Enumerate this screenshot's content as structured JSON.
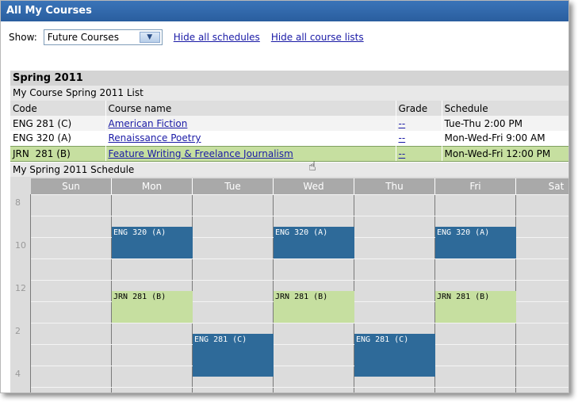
{
  "window": {
    "title": "All My Courses"
  },
  "show": {
    "label": "Show:",
    "selected": "Future Courses",
    "arrow_icon": "chevron-down-icon",
    "links": [
      "Hide all schedules",
      "Hide all course lists"
    ]
  },
  "term": {
    "name": "Spring 2011",
    "list_title": "My Course Spring 2011 List",
    "columns": [
      "Code",
      "Course name",
      "Grade",
      "Schedule"
    ],
    "courses": [
      {
        "code": "ENG 281 (C)",
        "name": "American Fiction",
        "grade": "--",
        "schedule": "Tue-Thu 2:00 PM"
      },
      {
        "code": "ENG 320 (A)",
        "name": "Renaissance Poetry",
        "grade": "--",
        "schedule": "Mon-Wed-Fri 9:00 AM"
      },
      {
        "code": "JRN  281 (B)",
        "name": "Feature Writing & Freelance Journalism",
        "grade": "--",
        "schedule": "Mon-Wed-Fri 12:00 PM"
      }
    ],
    "schedule_title": "My Spring 2011 Schedule"
  },
  "calendar": {
    "days": [
      "Sun",
      "Mon",
      "Tue",
      "Wed",
      "Thu",
      "Fri",
      "Sat"
    ],
    "hours": [
      "8",
      "10",
      "12",
      "2",
      "4"
    ],
    "events": [
      {
        "label": "ENG 320 (A)",
        "day": "Mon",
        "start": 9,
        "end": 10.5,
        "color": "#2e6a99"
      },
      {
        "label": "ENG 320 (A)",
        "day": "Wed",
        "start": 9,
        "end": 10.5,
        "color": "#2e6a99"
      },
      {
        "label": "ENG 320 (A)",
        "day": "Fri",
        "start": 9,
        "end": 10.5,
        "color": "#2e6a99"
      },
      {
        "label": "JRN 281 (B)",
        "day": "Mon",
        "start": 12,
        "end": 13.5,
        "color": "#c6dfa0"
      },
      {
        "label": "JRN 281 (B)",
        "day": "Wed",
        "start": 12,
        "end": 13.5,
        "color": "#c6dfa0"
      },
      {
        "label": "JRN 281 (B)",
        "day": "Fri",
        "start": 12,
        "end": 13.5,
        "color": "#c6dfa0"
      },
      {
        "label": "ENG 281 (C)",
        "day": "Tue",
        "start": 14,
        "end": 16,
        "color": "#2e6a99"
      },
      {
        "label": "ENG 281 (C)",
        "day": "Thu",
        "start": 14,
        "end": 16,
        "color": "#2e6a99"
      }
    ]
  },
  "colors": {
    "titlebar": "#2a5e9f",
    "selected_row": "#c6dfa0",
    "event_blue": "#2e6a99",
    "link": "#1a1aa6"
  }
}
